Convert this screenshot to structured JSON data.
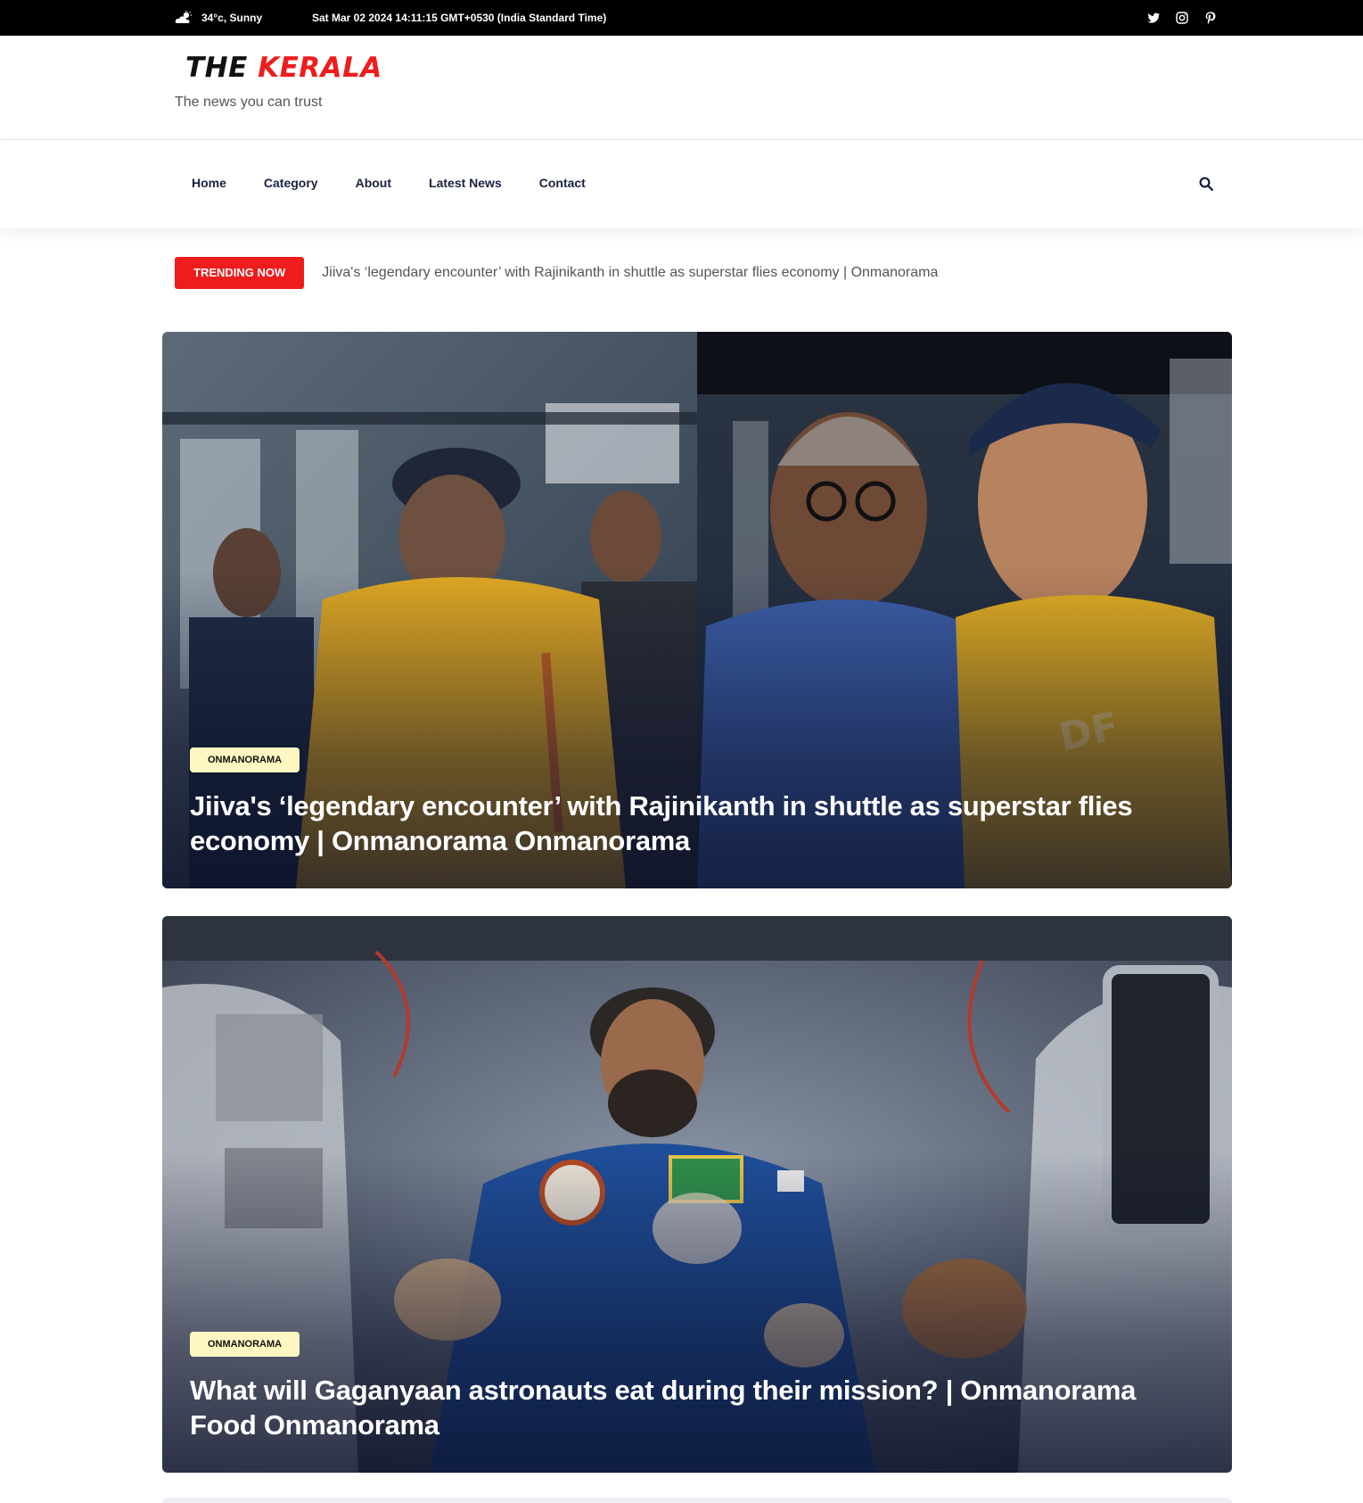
{
  "topbar": {
    "weather": "34°c, Sunny",
    "weather_icon": "cloud-sun-icon",
    "datetime": "Sat Mar 02 2024 14:11:15 GMT+0530 (India Standard Time)",
    "social_icons": [
      "twitter-icon",
      "instagram-icon",
      "pinterest-icon"
    ]
  },
  "brand": {
    "logo_part1": "THE",
    "logo_part2": "KERALA",
    "tagline": "The news you can trust",
    "colors": {
      "logo_accent": "#ee1c1c",
      "logo_dark": "#111111"
    }
  },
  "nav": {
    "items": [
      {
        "label": "Home"
      },
      {
        "label": "Category"
      },
      {
        "label": "About"
      },
      {
        "label": "Latest News"
      },
      {
        "label": "Contact"
      }
    ],
    "search_icon": "search-icon"
  },
  "trending": {
    "badge": "TRENDING NOW",
    "headline": "Jiiva's ‘legendary encounter’ with Rajinikanth in shuttle as superstar flies economy | Onmanorama",
    "badge_color": "#ee1c1c"
  },
  "featured": [
    {
      "tag": "ONMANORAMA",
      "title": "Jiiva's ‘legendary encounter’ with Rajinikanth in shuttle as superstar flies economy | Onmanorama Onmanorama"
    },
    {
      "tag": "ONMANORAMA",
      "title": "What will Gaganyaan astronauts eat during their mission? | Onmanorama Food Onmanorama"
    }
  ]
}
